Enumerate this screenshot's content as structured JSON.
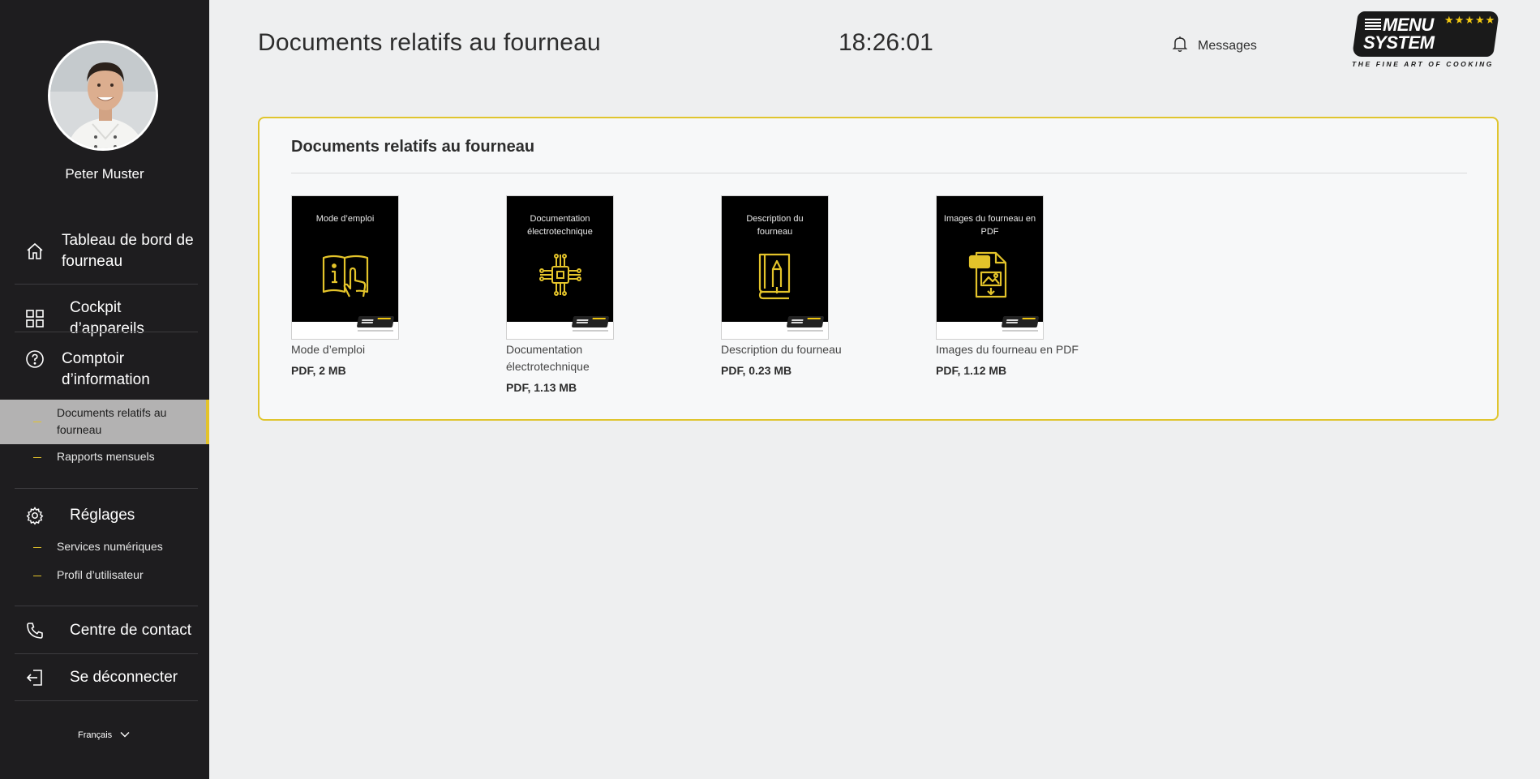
{
  "sidebar": {
    "user_name": "Peter Muster",
    "nav": {
      "dashboard": "Tableau de bord de fourneau",
      "cockpit": "Cockpit d’appareils",
      "info": "Comptoir d’information",
      "info_sub": [
        "Documents relatifs au fourneau",
        "Rapports mensuels"
      ],
      "settings": "Réglages",
      "settings_sub": [
        "Services numériques",
        "Profil d’utilisateur"
      ],
      "contact": "Centre de contact",
      "logout": "Se déconnecter"
    },
    "language": "Français",
    "accent_color": "#e3c32a"
  },
  "header": {
    "title": "Documents relatifs au fourneau",
    "time": "18:26:01",
    "messages_label": "Messages"
  },
  "logo": {
    "line1": "MENU",
    "line2": "SYSTEM",
    "stars": "★★★★★",
    "tagline": "THE FINE ART OF COOKING"
  },
  "card": {
    "title": "Documents relatifs au fourneau",
    "documents": [
      {
        "thumb_title": "Mode d’emploi",
        "name": "Mode d’emploi",
        "meta": "PDF, 2 MB",
        "icon": "manual-icon"
      },
      {
        "thumb_title": "Documentation électrotechnique",
        "name": "Documentation électrotechnique",
        "meta": "PDF, 1.13 MB",
        "icon": "circuit-chip-icon"
      },
      {
        "thumb_title": "Description du fourneau",
        "name": "Description du fourneau",
        "meta": "PDF, 0.23 MB",
        "icon": "book-pen-icon"
      },
      {
        "thumb_title": "Images du fourneau en PDF",
        "name": "Images du fourneau en PDF",
        "meta": "PDF, 1.12 MB",
        "icon": "pdf-image-icon"
      }
    ]
  }
}
